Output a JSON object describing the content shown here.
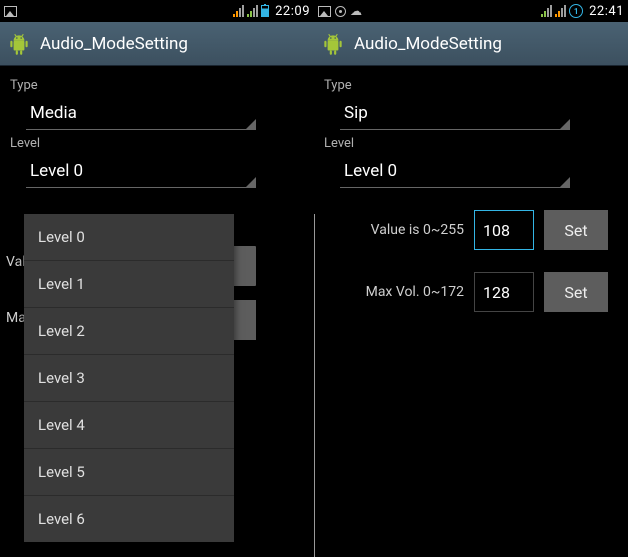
{
  "left": {
    "status": {
      "time": "22:09"
    },
    "title": "Audio_ModeSetting",
    "type_label": "Type",
    "type_value": "Media",
    "level_label": "Level",
    "level_selected": "Level 0",
    "peek1": "Valu",
    "peek2": "Max",
    "dropdown": {
      "items": [
        "Level 0",
        "Level 1",
        "Level 2",
        "Level 3",
        "Level 4",
        "Level 5",
        "Level 6"
      ]
    }
  },
  "right": {
    "status": {
      "time": "22:41"
    },
    "title": "Audio_ModeSetting",
    "type_label": "Type",
    "type_value": "Sip",
    "level_label": "Level",
    "level_selected": "Level 0",
    "value_label": "Value is 0~255",
    "value_input": "108",
    "maxvol_label": "Max Vol. 0~172",
    "maxvol_input": "128",
    "set_label": "Set"
  }
}
